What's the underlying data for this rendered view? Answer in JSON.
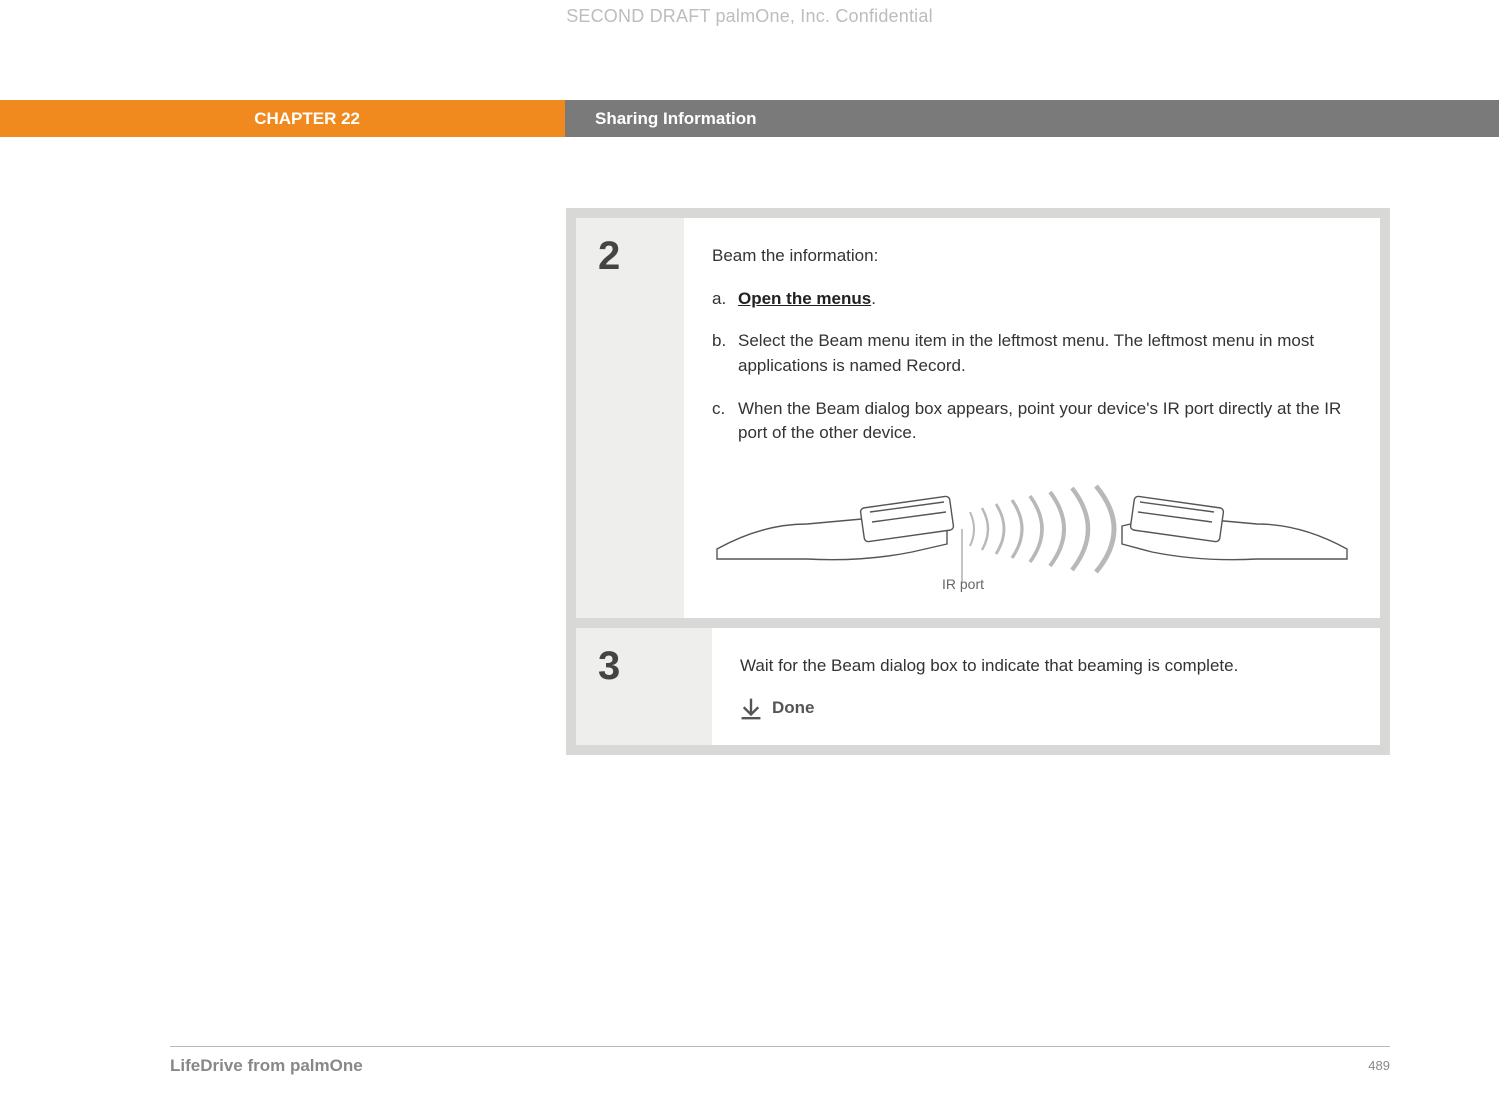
{
  "draft_header": "SECOND DRAFT palmOne, Inc.  Confidential",
  "chapter": {
    "label": "CHAPTER 22",
    "title": "Sharing Information"
  },
  "steps": {
    "s2": {
      "number": "2",
      "intro": "Beam the information:",
      "a_letter": "a.",
      "a_link": "Open the menus",
      "a_after": ".",
      "b_letter": "b.",
      "b_text": "Select the Beam menu item in the leftmost menu. The leftmost menu in most applications is named Record.",
      "c_letter": "c.",
      "c_text": "When the Beam dialog box appears, point your device's IR port directly at the IR port of the other device.",
      "ir_label": "IR port"
    },
    "s3": {
      "number": "3",
      "text": "Wait for the Beam dialog box to indicate that beaming is complete.",
      "done": "Done"
    }
  },
  "footer": {
    "product": "LifeDrive from palmOne",
    "page": "489"
  }
}
